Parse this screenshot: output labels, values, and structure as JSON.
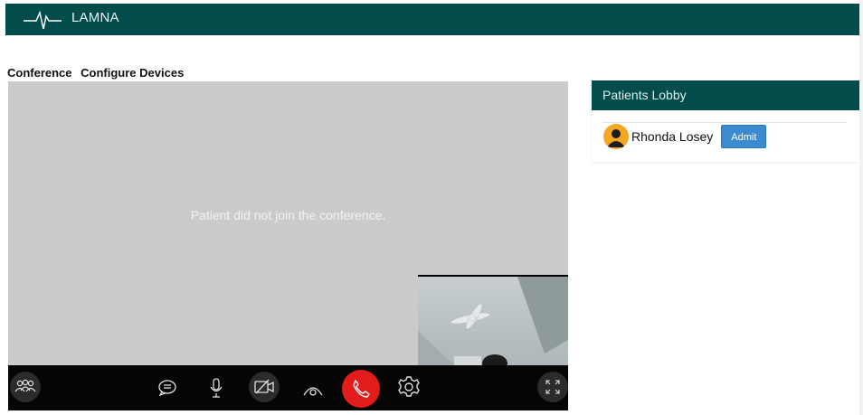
{
  "app": {
    "brand": "LAMNA"
  },
  "tabs": [
    {
      "label": "Conference"
    },
    {
      "label": "Configure Devices"
    }
  ],
  "video": {
    "message": "Patient did not join the conference."
  },
  "controls": [
    {
      "name": "participants-icon"
    },
    {
      "name": "chat-icon"
    },
    {
      "name": "microphone-icon"
    },
    {
      "name": "camera-off-icon"
    },
    {
      "name": "view-icon"
    },
    {
      "name": "hang-up-icon"
    },
    {
      "name": "settings-icon"
    },
    {
      "name": "fullscreen-icon"
    }
  ],
  "lobby": {
    "title": "Patients Lobby",
    "patients": [
      {
        "name": "Rhonda Losey",
        "action": "Admit"
      }
    ]
  },
  "colors": {
    "brand": "#024c4b",
    "hangup": "#e21b1b",
    "admit": "#3b8bd0"
  }
}
